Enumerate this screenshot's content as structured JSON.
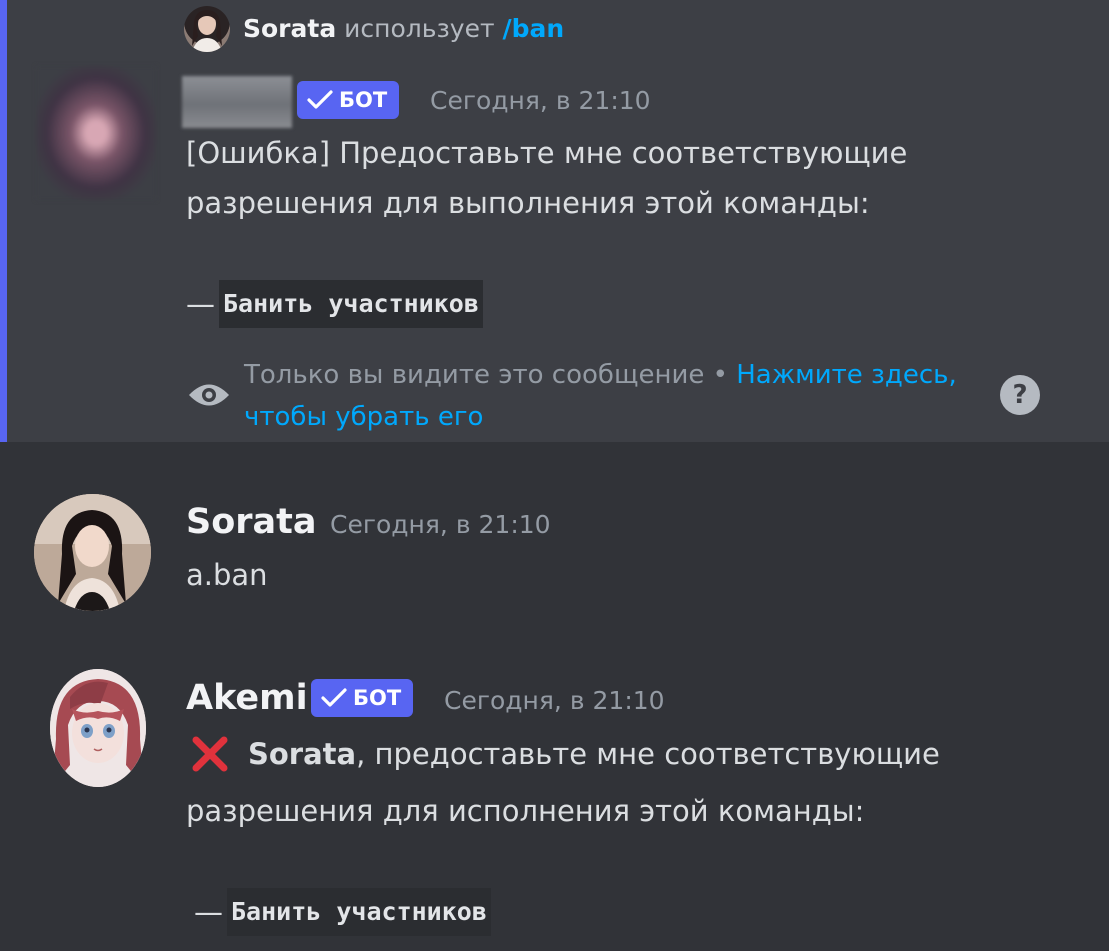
{
  "colors": {
    "background": "#313338",
    "highlight_background": "#3d3f45",
    "accent_bar": "#5865f2",
    "bot_tag": "#5865f2",
    "link": "#00a8fc",
    "error_icon": "#e0323c"
  },
  "ephemeral": {
    "reply": {
      "username": "Sorata",
      "uses_text": "использует",
      "command": "/ban"
    },
    "message": {
      "bot_tag_label": "БОТ",
      "timestamp": "Сегодня, в 21:10",
      "line1": "[Ошибка] Предоставьте мне соответствующие",
      "line2": "разрешения для выполнения этой команды:",
      "permission_dash": "—",
      "permission_code": "Банить участников"
    },
    "notice": {
      "text": "Только вы видите это сообщение",
      "separator": "•",
      "link_part1": "Нажмите здесь,",
      "link_part2": "чтобы убрать его",
      "help_icon": "?"
    }
  },
  "messages": [
    {
      "username": "Sorata",
      "timestamp": "Сегодня, в 21:10",
      "content": "a.ban"
    },
    {
      "username": "Akemi",
      "bot_tag_label": "БОТ",
      "timestamp": "Сегодня, в 21:10",
      "icon": "x-mark-icon",
      "mention": "Sorata",
      "line1_rest": ", предоставьте мне соответствующие",
      "line2": "разрешения для исполнения этой команды:",
      "permission_dash": "—",
      "permission_code": "Банить участников"
    }
  ]
}
